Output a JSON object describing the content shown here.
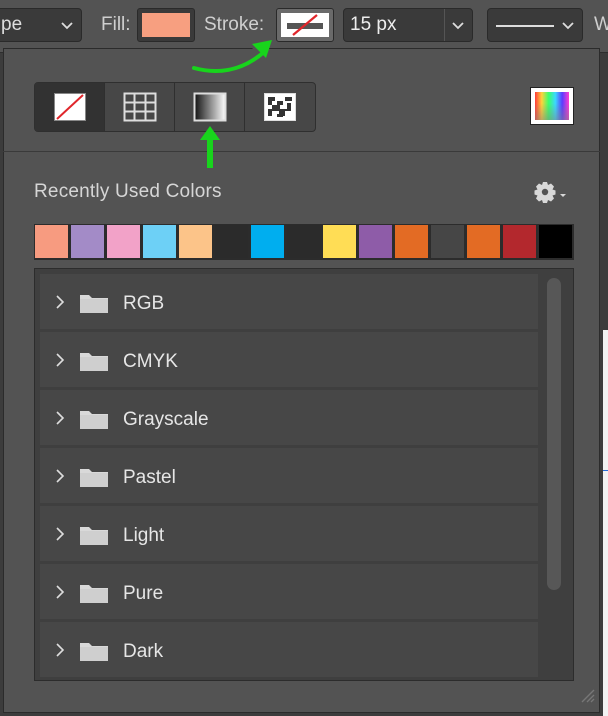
{
  "options_bar": {
    "mode_value": "pe",
    "fill_label": "Fill:",
    "stroke_label": "Stroke:",
    "stroke_size": "15 px",
    "trailing_label": "W"
  },
  "colors": {
    "fill_swatch": "#f79f80",
    "annotation_arrow": "#18d41c"
  },
  "panel": {
    "type_buttons": [
      {
        "name": "no-color",
        "active": true
      },
      {
        "name": "solid-color",
        "active": false
      },
      {
        "name": "gradient",
        "active": false
      },
      {
        "name": "pattern",
        "active": false
      }
    ],
    "recent_title": "Recently Used Colors",
    "recent_colors": [
      "#f79b80",
      "#a38bc7",
      "#f2a2c8",
      "#6dd0f6",
      "#fcc489",
      "#2b2b2b",
      "#00aeef",
      "#2b2b2b",
      "#ffdd55",
      "#8e5ca8",
      "#e36b24",
      "#464646",
      "#e36b24",
      "#b3282d",
      "#000000"
    ],
    "folders": [
      "RGB",
      "CMYK",
      "Grayscale",
      "Pastel",
      "Light",
      "Pure",
      "Dark"
    ]
  }
}
